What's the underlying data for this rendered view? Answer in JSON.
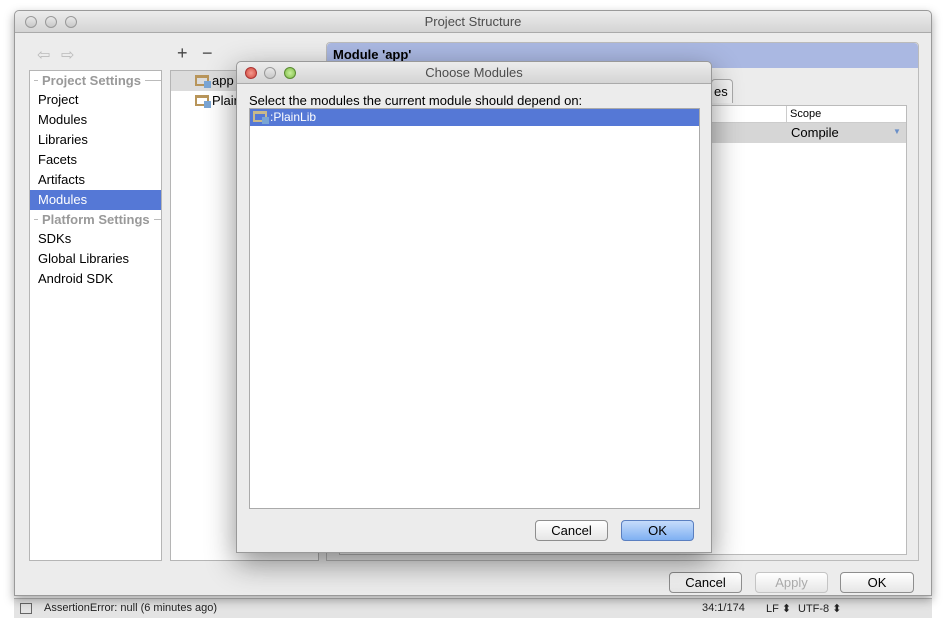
{
  "window": {
    "title": "Project Structure"
  },
  "toolbar": {
    "back": "⇦",
    "forward": "⇨",
    "add": "+",
    "remove": "−"
  },
  "sidebar": {
    "groups": [
      {
        "label": "Project Settings",
        "items": [
          "Project",
          "Modules",
          "Libraries",
          "Facets",
          "Artifacts",
          "Modules"
        ]
      },
      {
        "label": "Platform Settings",
        "items": [
          "SDKs",
          "Global Libraries",
          "Android SDK"
        ]
      }
    ],
    "selected": "Modules"
  },
  "modules": [
    "app",
    "PlainLib"
  ],
  "detail": {
    "header": "Module 'app'",
    "tab_partial": "es",
    "table": {
      "columns": [
        "",
        "Scope"
      ],
      "rows": [
        {
          "scope": "Compile"
        }
      ]
    }
  },
  "buttons": {
    "cancel": "Cancel",
    "apply": "Apply",
    "ok": "OK"
  },
  "status": {
    "message": "AssertionError: null (6 minutes ago)",
    "position": "34:1/174",
    "line_sep": "LF ⬍",
    "encoding": "UTF-8 ⬍"
  },
  "dialog": {
    "title": "Choose Modules",
    "prompt": "Select the modules the current module should depend on:",
    "items": [
      ":PlainLib"
    ],
    "cancel": "Cancel",
    "ok": "OK"
  }
}
